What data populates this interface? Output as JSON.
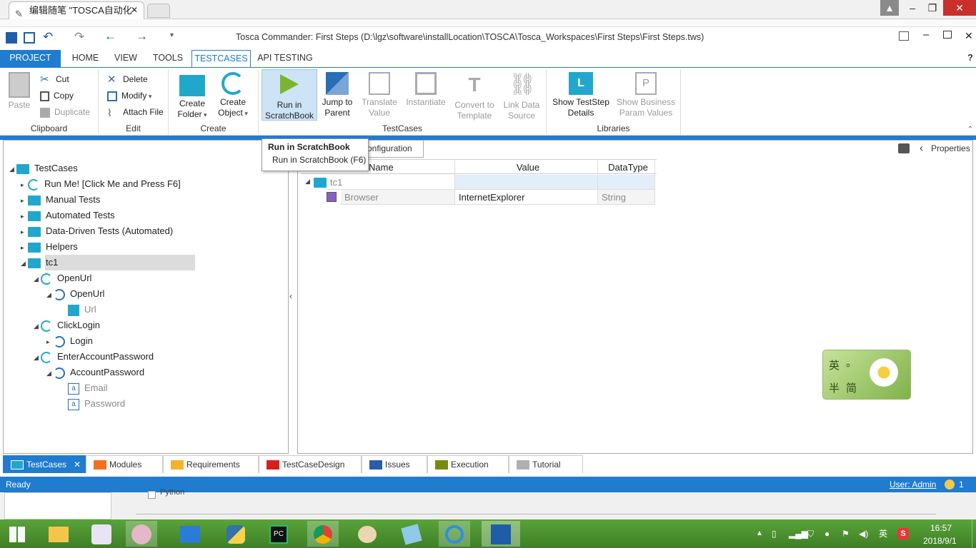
{
  "browser": {
    "tab_title": "编辑随笔 \"TOSCA自动化",
    "window_buttons": [
      "–",
      "❐",
      "✕"
    ]
  },
  "app": {
    "title": "Tosca Commander: First Steps (D:\\lgz\\software\\installLocation\\TOSCA\\Tosca_Workspaces\\First Steps\\First Steps.tws)",
    "ribbon_tabs": [
      {
        "label": "PROJECT",
        "active": "project"
      },
      {
        "label": "HOME"
      },
      {
        "label": "VIEW"
      },
      {
        "label": "TOOLS"
      },
      {
        "label": "TESTCASES",
        "active": "selected"
      },
      {
        "label": "API TESTING"
      }
    ],
    "help": "?",
    "groups": {
      "clipboard": {
        "label": "Clipboard",
        "paste": "Paste",
        "cut": "Cut",
        "copy": "Copy",
        "duplicate": "Duplicate"
      },
      "edit": {
        "label": "Edit",
        "delete": "Delete",
        "modify": "Modify",
        "attach": "Attach File"
      },
      "create": {
        "label": "Create",
        "folder_l1": "Create",
        "folder_l2": "Folder",
        "object_l1": "Create",
        "object_l2": "Object"
      },
      "testcases": {
        "label": "TestCases",
        "run_l1": "Run in",
        "run_l2": "ScratchBook",
        "jump_l1": "Jump to",
        "jump_l2": "Parent",
        "translate_l1": "Translate",
        "translate_l2": "Value",
        "instantiate": "Instantiate",
        "convert_l1": "Convert to",
        "convert_l2": "Template",
        "link_l1": "Link Data",
        "link_l2": "Source"
      },
      "libraries": {
        "label": "Libraries",
        "show_l1": "Show TestStep",
        "show_l2": "Details",
        "business_l1": "Show Business",
        "business_l2": "Param Values"
      }
    },
    "tooltip": {
      "title": "Run in ScratchBook",
      "body": "Run in ScratchBook (F6)"
    },
    "tree": [
      {
        "label": "TestCases"
      },
      {
        "label": "Run Me! [Click Me and Press F6]"
      },
      {
        "label": "Manual Tests"
      },
      {
        "label": "Automated Tests"
      },
      {
        "label": "Data-Driven Tests (Automated)"
      },
      {
        "label": "Helpers"
      },
      {
        "label": "tc1"
      },
      {
        "label": "OpenUrl"
      },
      {
        "label": "OpenUrl"
      },
      {
        "label": "Url"
      },
      {
        "label": "ClickLogin"
      },
      {
        "label": "Login"
      },
      {
        "label": "EnterAccountPassword"
      },
      {
        "label": "AccountPassword"
      },
      {
        "label": "Email"
      },
      {
        "label": "Password"
      }
    ],
    "right": {
      "tab_label": "onfiguration",
      "properties": "Properties",
      "columns": [
        "Name",
        "Value",
        "DataType"
      ],
      "rows": [
        {
          "name": "tc1",
          "value": "",
          "type": ""
        },
        {
          "name": "Browser",
          "value": "InternetExplorer",
          "type": "String"
        }
      ]
    },
    "bottom_tabs": [
      {
        "label": "TestCases",
        "color": "#22a7cc",
        "close": "✕"
      },
      {
        "label": "Modules",
        "color": "#f07020"
      },
      {
        "label": "Requirements",
        "color": "#f6b12b"
      },
      {
        "label": "TestCaseDesign",
        "color": "#d91e1e"
      },
      {
        "label": "Issues",
        "color": "#2a5ca8"
      },
      {
        "label": "Execution",
        "color": "#7a8a10"
      },
      {
        "label": "Tutorial",
        "color": "#b0b0b0"
      }
    ],
    "status": {
      "left": "Ready",
      "user": "User: Admin",
      "count": "1"
    }
  },
  "ime": {
    "c1": "英",
    "c2": "。",
    "c3": "半",
    "c4": "简"
  },
  "behind": {
    "text": "Python"
  },
  "taskbar": {
    "time": "16:57",
    "date": "2018/9/1",
    "lang": "英"
  }
}
